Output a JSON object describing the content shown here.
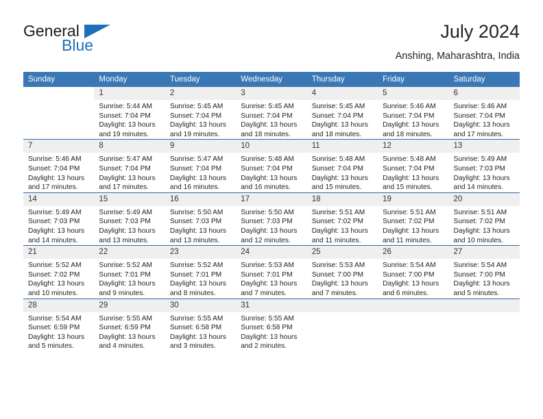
{
  "brand": {
    "name_part1": "General",
    "name_part2": "Blue",
    "triangle_color": "#1d6fb8"
  },
  "header": {
    "title": "July 2024",
    "subtitle": "Anshing, Maharashtra, India"
  },
  "theme": {
    "header_bg": "#3a77b5",
    "row_divider": "#2b6cab",
    "daynum_bg": "#efefef"
  },
  "weekday_headers": [
    "Sunday",
    "Monday",
    "Tuesday",
    "Wednesday",
    "Thursday",
    "Friday",
    "Saturday"
  ],
  "weeks": [
    [
      {
        "day": "",
        "sunrise": "",
        "sunset": "",
        "daylight_line1": "",
        "daylight_line2": "",
        "empty": true
      },
      {
        "day": "1",
        "sunrise": "Sunrise: 5:44 AM",
        "sunset": "Sunset: 7:04 PM",
        "daylight_line1": "Daylight: 13 hours",
        "daylight_line2": "and 19 minutes."
      },
      {
        "day": "2",
        "sunrise": "Sunrise: 5:45 AM",
        "sunset": "Sunset: 7:04 PM",
        "daylight_line1": "Daylight: 13 hours",
        "daylight_line2": "and 19 minutes."
      },
      {
        "day": "3",
        "sunrise": "Sunrise: 5:45 AM",
        "sunset": "Sunset: 7:04 PM",
        "daylight_line1": "Daylight: 13 hours",
        "daylight_line2": "and 18 minutes."
      },
      {
        "day": "4",
        "sunrise": "Sunrise: 5:45 AM",
        "sunset": "Sunset: 7:04 PM",
        "daylight_line1": "Daylight: 13 hours",
        "daylight_line2": "and 18 minutes."
      },
      {
        "day": "5",
        "sunrise": "Sunrise: 5:46 AM",
        "sunset": "Sunset: 7:04 PM",
        "daylight_line1": "Daylight: 13 hours",
        "daylight_line2": "and 18 minutes."
      },
      {
        "day": "6",
        "sunrise": "Sunrise: 5:46 AM",
        "sunset": "Sunset: 7:04 PM",
        "daylight_line1": "Daylight: 13 hours",
        "daylight_line2": "and 17 minutes."
      }
    ],
    [
      {
        "day": "7",
        "sunrise": "Sunrise: 5:46 AM",
        "sunset": "Sunset: 7:04 PM",
        "daylight_line1": "Daylight: 13 hours",
        "daylight_line2": "and 17 minutes."
      },
      {
        "day": "8",
        "sunrise": "Sunrise: 5:47 AM",
        "sunset": "Sunset: 7:04 PM",
        "daylight_line1": "Daylight: 13 hours",
        "daylight_line2": "and 17 minutes."
      },
      {
        "day": "9",
        "sunrise": "Sunrise: 5:47 AM",
        "sunset": "Sunset: 7:04 PM",
        "daylight_line1": "Daylight: 13 hours",
        "daylight_line2": "and 16 minutes."
      },
      {
        "day": "10",
        "sunrise": "Sunrise: 5:48 AM",
        "sunset": "Sunset: 7:04 PM",
        "daylight_line1": "Daylight: 13 hours",
        "daylight_line2": "and 16 minutes."
      },
      {
        "day": "11",
        "sunrise": "Sunrise: 5:48 AM",
        "sunset": "Sunset: 7:04 PM",
        "daylight_line1": "Daylight: 13 hours",
        "daylight_line2": "and 15 minutes."
      },
      {
        "day": "12",
        "sunrise": "Sunrise: 5:48 AM",
        "sunset": "Sunset: 7:04 PM",
        "daylight_line1": "Daylight: 13 hours",
        "daylight_line2": "and 15 minutes."
      },
      {
        "day": "13",
        "sunrise": "Sunrise: 5:49 AM",
        "sunset": "Sunset: 7:03 PM",
        "daylight_line1": "Daylight: 13 hours",
        "daylight_line2": "and 14 minutes."
      }
    ],
    [
      {
        "day": "14",
        "sunrise": "Sunrise: 5:49 AM",
        "sunset": "Sunset: 7:03 PM",
        "daylight_line1": "Daylight: 13 hours",
        "daylight_line2": "and 14 minutes."
      },
      {
        "day": "15",
        "sunrise": "Sunrise: 5:49 AM",
        "sunset": "Sunset: 7:03 PM",
        "daylight_line1": "Daylight: 13 hours",
        "daylight_line2": "and 13 minutes."
      },
      {
        "day": "16",
        "sunrise": "Sunrise: 5:50 AM",
        "sunset": "Sunset: 7:03 PM",
        "daylight_line1": "Daylight: 13 hours",
        "daylight_line2": "and 13 minutes."
      },
      {
        "day": "17",
        "sunrise": "Sunrise: 5:50 AM",
        "sunset": "Sunset: 7:03 PM",
        "daylight_line1": "Daylight: 13 hours",
        "daylight_line2": "and 12 minutes."
      },
      {
        "day": "18",
        "sunrise": "Sunrise: 5:51 AM",
        "sunset": "Sunset: 7:02 PM",
        "daylight_line1": "Daylight: 13 hours",
        "daylight_line2": "and 11 minutes."
      },
      {
        "day": "19",
        "sunrise": "Sunrise: 5:51 AM",
        "sunset": "Sunset: 7:02 PM",
        "daylight_line1": "Daylight: 13 hours",
        "daylight_line2": "and 11 minutes."
      },
      {
        "day": "20",
        "sunrise": "Sunrise: 5:51 AM",
        "sunset": "Sunset: 7:02 PM",
        "daylight_line1": "Daylight: 13 hours",
        "daylight_line2": "and 10 minutes."
      }
    ],
    [
      {
        "day": "21",
        "sunrise": "Sunrise: 5:52 AM",
        "sunset": "Sunset: 7:02 PM",
        "daylight_line1": "Daylight: 13 hours",
        "daylight_line2": "and 10 minutes."
      },
      {
        "day": "22",
        "sunrise": "Sunrise: 5:52 AM",
        "sunset": "Sunset: 7:01 PM",
        "daylight_line1": "Daylight: 13 hours",
        "daylight_line2": "and 9 minutes."
      },
      {
        "day": "23",
        "sunrise": "Sunrise: 5:52 AM",
        "sunset": "Sunset: 7:01 PM",
        "daylight_line1": "Daylight: 13 hours",
        "daylight_line2": "and 8 minutes."
      },
      {
        "day": "24",
        "sunrise": "Sunrise: 5:53 AM",
        "sunset": "Sunset: 7:01 PM",
        "daylight_line1": "Daylight: 13 hours",
        "daylight_line2": "and 7 minutes."
      },
      {
        "day": "25",
        "sunrise": "Sunrise: 5:53 AM",
        "sunset": "Sunset: 7:00 PM",
        "daylight_line1": "Daylight: 13 hours",
        "daylight_line2": "and 7 minutes."
      },
      {
        "day": "26",
        "sunrise": "Sunrise: 5:54 AM",
        "sunset": "Sunset: 7:00 PM",
        "daylight_line1": "Daylight: 13 hours",
        "daylight_line2": "and 6 minutes."
      },
      {
        "day": "27",
        "sunrise": "Sunrise: 5:54 AM",
        "sunset": "Sunset: 7:00 PM",
        "daylight_line1": "Daylight: 13 hours",
        "daylight_line2": "and 5 minutes."
      }
    ],
    [
      {
        "day": "28",
        "sunrise": "Sunrise: 5:54 AM",
        "sunset": "Sunset: 6:59 PM",
        "daylight_line1": "Daylight: 13 hours",
        "daylight_line2": "and 5 minutes."
      },
      {
        "day": "29",
        "sunrise": "Sunrise: 5:55 AM",
        "sunset": "Sunset: 6:59 PM",
        "daylight_line1": "Daylight: 13 hours",
        "daylight_line2": "and 4 minutes."
      },
      {
        "day": "30",
        "sunrise": "Sunrise: 5:55 AM",
        "sunset": "Sunset: 6:58 PM",
        "daylight_line1": "Daylight: 13 hours",
        "daylight_line2": "and 3 minutes."
      },
      {
        "day": "31",
        "sunrise": "Sunrise: 5:55 AM",
        "sunset": "Sunset: 6:58 PM",
        "daylight_line1": "Daylight: 13 hours",
        "daylight_line2": "and 2 minutes."
      },
      {
        "day": "",
        "sunrise": "",
        "sunset": "",
        "daylight_line1": "",
        "daylight_line2": "",
        "empty": true
      },
      {
        "day": "",
        "sunrise": "",
        "sunset": "",
        "daylight_line1": "",
        "daylight_line2": "",
        "empty": true
      },
      {
        "day": "",
        "sunrise": "",
        "sunset": "",
        "daylight_line1": "",
        "daylight_line2": "",
        "empty": true
      }
    ]
  ]
}
